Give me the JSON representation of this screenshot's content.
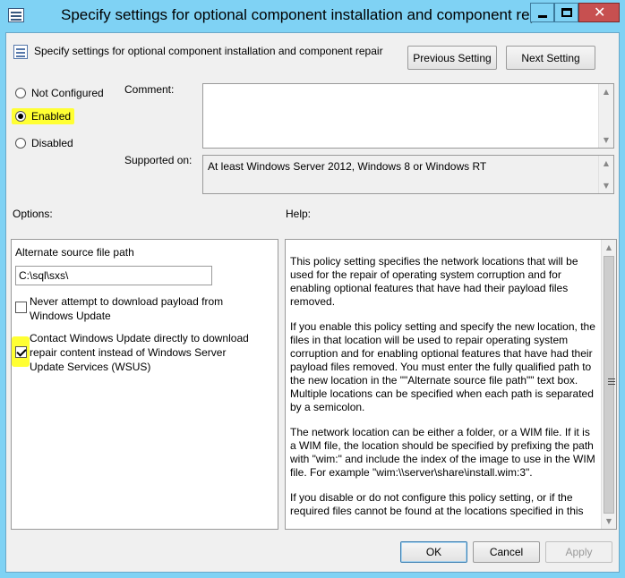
{
  "window": {
    "title": "Specify settings for optional component installation and component repair",
    "close_glyph": "✕"
  },
  "header": {
    "setting_name": "Specify settings for optional component installation and component repair",
    "previous_label": "Previous Setting",
    "next_label": "Next Setting"
  },
  "state": {
    "options": [
      {
        "label": "Not Configured",
        "checked": false
      },
      {
        "label": "Enabled",
        "checked": true
      },
      {
        "label": "Disabled",
        "checked": false
      }
    ]
  },
  "comment": {
    "label": "Comment:",
    "value": ""
  },
  "supported": {
    "label": "Supported on:",
    "value": "At least Windows Server 2012, Windows 8 or Windows RT"
  },
  "options_section": {
    "label": "Options:",
    "alt_source_label": "Alternate source file path",
    "alt_source_value": "C:\\sql\\sxs\\",
    "never_download_label": [
      "Never attempt to download payload from",
      "Windows Update"
    ],
    "never_download_checked": false,
    "contact_wu_label": [
      "Contact Windows Update directly to download",
      "repair content instead of Windows Server",
      "Update Services (WSUS)"
    ],
    "contact_wu_checked": true
  },
  "help_section": {
    "label": "Help:",
    "paragraphs": [
      "This policy setting specifies the network locations that will be used for the repair of operating system corruption and for enabling optional features that have had their payload files removed.",
      "If you enable this policy setting and specify the new location, the files in that location will be used to repair operating system corruption and for enabling optional features that have had their payload files removed. You must enter the fully qualified path to the new location in the \"\"Alternate source file path\"\" text box. Multiple locations can be specified when each path is separated by a semicolon.",
      "The network location can be either a folder, or a WIM file. If it is a WIM file, the location should be specified by prefixing the path with \"wim:\" and include the index of the image to use in the WIM file. For example \"wim:\\\\server\\share\\install.wim:3\".",
      "If you disable or do not configure this policy setting, or if the required files cannot be found at the locations specified in this"
    ]
  },
  "footer": {
    "ok_label": "OK",
    "cancel_label": "Cancel",
    "apply_label": "Apply"
  },
  "colors": {
    "title_bar": "#7fd2f4",
    "close_button": "#c75050",
    "highlight": "#ffff33",
    "dialog_bg": "#f0f0f0"
  }
}
